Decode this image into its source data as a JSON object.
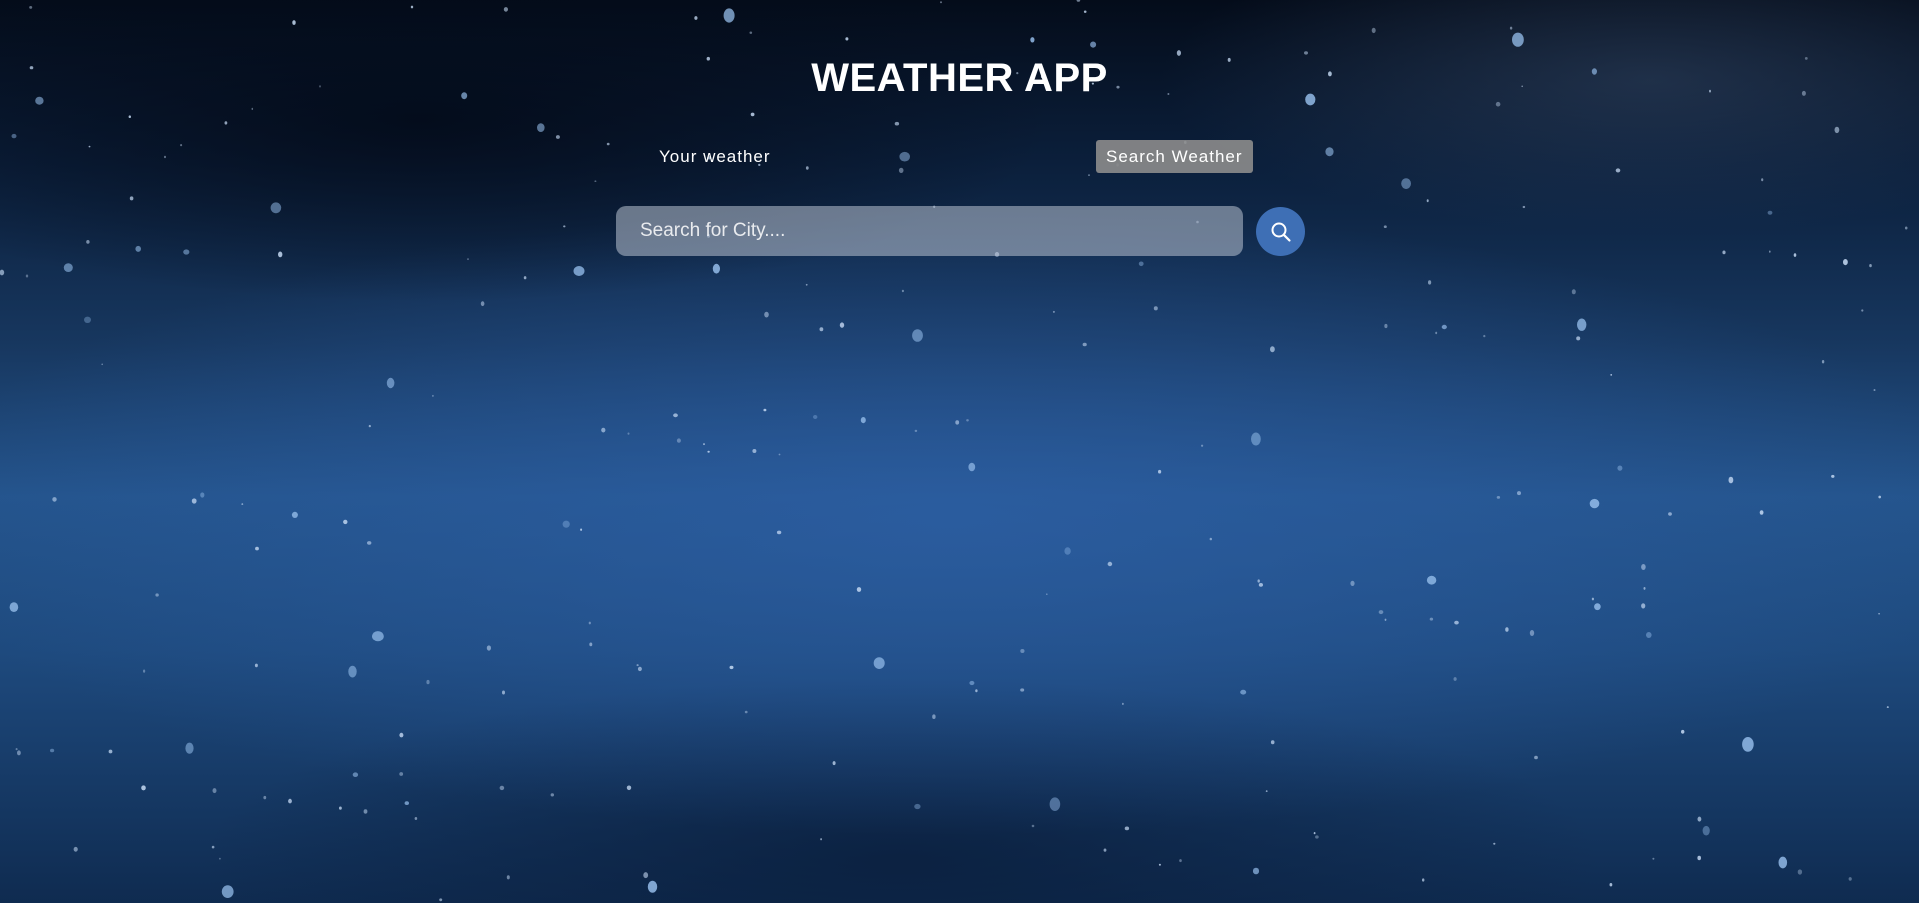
{
  "app": {
    "title": "WEATHER APP"
  },
  "tabs": [
    {
      "label": "Your weather",
      "active": false
    },
    {
      "label": "Search Weather",
      "active": true
    }
  ],
  "search": {
    "value": "",
    "placeholder": "Search for City....",
    "button_icon": "search-icon"
  },
  "theme": {
    "accent": "#3e6fb5",
    "active_tab_bg": "#8c8c8c",
    "text": "#ffffff",
    "background_image": "rain-drops-night-photo"
  }
}
